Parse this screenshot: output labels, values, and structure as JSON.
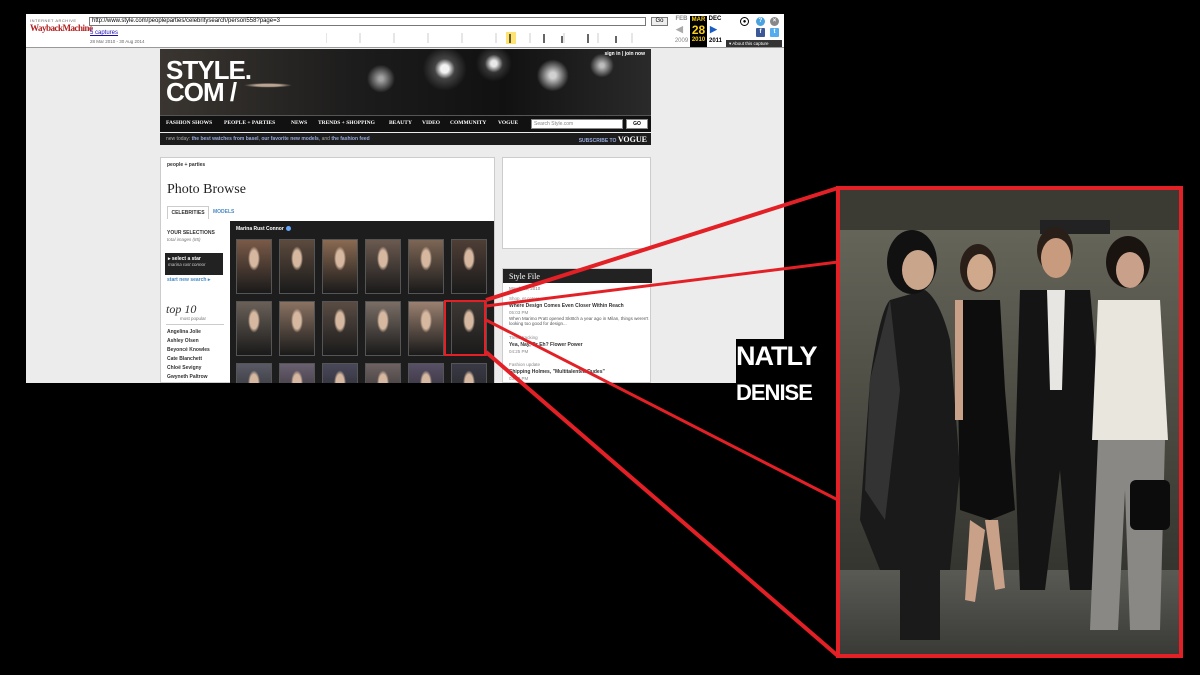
{
  "wayback": {
    "logo_line1": "INTERNET ARCHIVE",
    "logo_line2": "WaybackMachine",
    "url": "http://www.style.com/peopleparties/celebritysearch/person558?page=3",
    "go_label": "Go",
    "captures_label": "5 captures",
    "date_range": "28 Mar 2010 - 30 Aug 2014",
    "prev_month": "FEB",
    "cur_month": "MAR",
    "next_month": "DEC",
    "cur_day": "28",
    "prev_year": "2009",
    "cur_year": "2010",
    "next_year": "2011",
    "about_label": "About this capture",
    "help_icon_text": "?",
    "close_icon_text": "×",
    "fb_icon_text": "f",
    "tw_icon_text": "t"
  },
  "site": {
    "logo_line1": "STYLE.",
    "logo_line2": "COM /",
    "sign_in": "sign in | join now",
    "nav": [
      "FASHION SHOWS",
      "PEOPLE + PARTIES",
      "NEWS",
      "TRENDS + SHOPPING",
      "BEAUTY",
      "VIDEO",
      "COMMUNITY",
      "VOGUE"
    ],
    "search_placeholder": "Search Style.com",
    "search_go": "GO",
    "ticker_prefix": "new today: ",
    "ticker_link1": "the best watches from basel",
    "ticker_mid1": ", ",
    "ticker_link2": "our favorite new models",
    "ticker_mid2": ", and ",
    "ticker_link3": "the fashion feed",
    "subscribe_label": "SUBSCRIBE TO",
    "subscribe_brand": "VOGUE",
    "breadcrumb": "people + parties",
    "page_title": "Photo Browse",
    "tab_celebrities": "CELEBRITIES",
    "tab_models": "MODELS",
    "selections_title": "YOUR SELECTIONS",
    "selections_sub": "total images (85)",
    "select_star_label": "▸ select a star",
    "select_star_value": "marina rust connor",
    "start_new": "start new search ▸",
    "top10_title": "top 10",
    "top10_sub": "most popular",
    "top10_items": [
      "Angelina Jolie",
      "Ashley Olsen",
      "Beyoncé Knowles",
      "Cate Blanchett",
      "Chloë Sevigny",
      "Gwyneth Paltrow"
    ],
    "grid_title": "Marina Rust Connor",
    "sf_head": "Style File",
    "sf_date": "March 28, 2010",
    "sf_items": [
      {
        "cat": "Shop, et cetera",
        "title": "Where Design Comes Even Closer Within Reach",
        "time": "05:03 PM",
        "desc": "When Marimo Pratt opened Sk8tch a year ago in Milan, things weren't looking too good for design..."
      },
      {
        "cat": "Trend tracking",
        "title": "Yea, Nay, Or Eh? Flower Power",
        "time": "04:25 PM",
        "desc": ""
      },
      {
        "cat": "Fashion update",
        "title": "Shipping Holmes, \"Multitalented Dudes\"",
        "time": "03:03 PM",
        "desc": ""
      }
    ]
  },
  "watermark": {
    "line1": "NATLY",
    "line2": "DENISE"
  },
  "colors": {
    "highlight": "#e32026",
    "accent_link": "#4a8ac4",
    "wayback_day": "#fcd116"
  },
  "icons": [
    "user-icon",
    "help-icon",
    "close-icon",
    "facebook-icon",
    "twitter-icon",
    "arrow-left-icon",
    "arrow-right-icon"
  ]
}
